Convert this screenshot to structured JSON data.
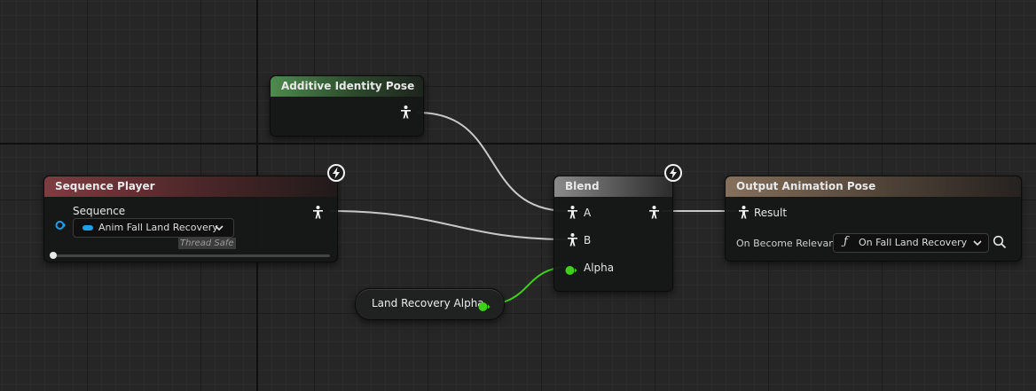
{
  "nodes": {
    "additive_identity_pose": {
      "title": "Additive Identity Pose"
    },
    "sequence_player": {
      "title": "Sequence Player",
      "sequence_label": "Sequence",
      "sequence_value": "Anim Fall Land Recovery",
      "thread_safe_label": "Thread Safe"
    },
    "blend": {
      "title": "Blend",
      "pin_a": "A",
      "pin_b": "B",
      "pin_alpha": "Alpha"
    },
    "output_pose": {
      "title": "Output Animation Pose",
      "result_label": "Result",
      "on_become_relevant_label": "On Become Relevant",
      "on_become_relevant_value": "On Fall Land Recovery S",
      "function_symbol": "ƒ"
    },
    "land_recovery_alpha": {
      "label": "Land Recovery Alpha"
    }
  },
  "colors": {
    "pose_wire": "#c8c8c8",
    "float_pin": "#3fd118",
    "object_pin": "#1f9fe8",
    "additive_header": "#4e8a4e",
    "sequence_header": "#7e3c40",
    "blend_header": "#8a8a8a",
    "output_header": "#85705c"
  },
  "icons": {
    "pose_pin": "person-pose-icon",
    "fast_path": "lightning-bolt-icon",
    "search": "magnifier-icon",
    "dropdown": "chevron-down-icon"
  }
}
